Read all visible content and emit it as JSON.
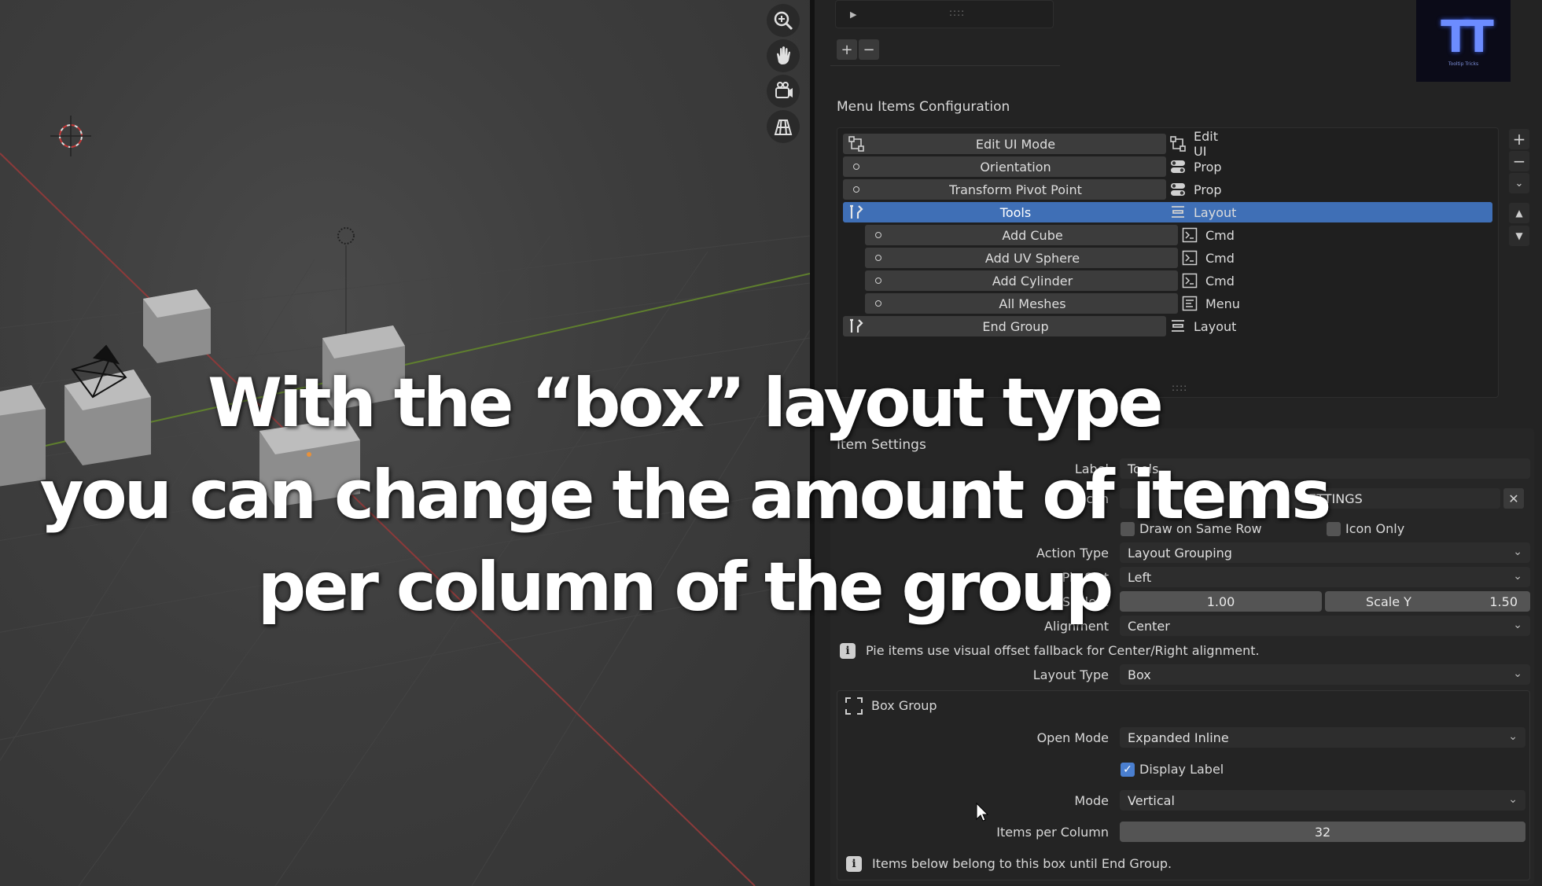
{
  "viewport": {
    "tools": [
      "zoom-icon",
      "pan-hand-icon",
      "camera-icon",
      "grid-view-icon"
    ]
  },
  "top_list": {
    "add_label": "+",
    "remove_label": "−"
  },
  "logo": {
    "text": "TT",
    "subtitle": "Tooltip Tricks"
  },
  "menu_config": {
    "title": "Menu Items Configuration",
    "rows": [
      {
        "name": "Edit UI Mode",
        "type": "Edit UI",
        "lead": "tree",
        "type_icon": "tree",
        "indent": false,
        "selected": false
      },
      {
        "name": "Orientation",
        "type": "Prop",
        "lead": "dot",
        "type_icon": "toggle",
        "indent": false,
        "selected": false
      },
      {
        "name": "Transform Pivot Point",
        "type": "Prop",
        "lead": "dot",
        "type_icon": "toggle",
        "indent": false,
        "selected": false
      },
      {
        "name": "Tools",
        "type": "Layout",
        "lead": "tools",
        "type_icon": "layout",
        "indent": false,
        "selected": true
      },
      {
        "name": "Add Cube",
        "type": "Cmd",
        "lead": "dot",
        "type_icon": "console",
        "indent": true,
        "selected": false
      },
      {
        "name": "Add UV Sphere",
        "type": "Cmd",
        "lead": "dot",
        "type_icon": "console",
        "indent": true,
        "selected": false
      },
      {
        "name": "Add Cylinder",
        "type": "Cmd",
        "lead": "dot",
        "type_icon": "console",
        "indent": true,
        "selected": false
      },
      {
        "name": "All Meshes",
        "type": "Menu",
        "lead": "dot",
        "type_icon": "menu",
        "indent": true,
        "selected": false
      },
      {
        "name": "End Group",
        "type": "Layout",
        "lead": "tools",
        "type_icon": "layout",
        "indent": false,
        "selected": false
      }
    ]
  },
  "item_settings": {
    "title": "Item Settings",
    "label_label": "Label",
    "label_value": "Tools",
    "icon_label": "Icon",
    "icon_value": "SETTINGS",
    "draw_same_row": "Draw on Same Row",
    "icon_only": "Icon Only",
    "action_type_label": "Action Type",
    "action_type_value": "Layout Grouping",
    "slot_label": "Pie Slot",
    "slot_value": "Left",
    "scale_x_label": "Scale X",
    "scale_x_value": "1.00",
    "scale_y_label": "Scale Y",
    "scale_y_value": "1.50",
    "alignment_label": "Alignment",
    "alignment_value": "Center",
    "pie_info": "Pie items use visual offset fallback for Center/Right alignment.",
    "layout_type_label": "Layout Type",
    "layout_type_value": "Box"
  },
  "box_group": {
    "title": "Box Group",
    "open_mode_label": "Open Mode",
    "open_mode_value": "Expanded Inline",
    "display_label": "Display Label",
    "display_label_checked": true,
    "mode_label": "Mode",
    "mode_value": "Vertical",
    "items_per_column_label": "Items per Column",
    "items_per_column_value": "32",
    "info": "Items below belong to this box until End Group."
  },
  "caption": {
    "line1": "With the “box” layout type",
    "line2": "you can change the amount of items",
    "line3": "per column of the group"
  }
}
